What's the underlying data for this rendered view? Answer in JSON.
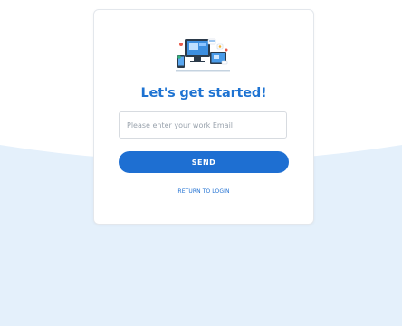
{
  "form": {
    "heading": "Let's get started!",
    "email_placeholder": "Please enter your work Email",
    "email_value": "",
    "send_label": "SEND",
    "return_label": "RETURN TO LOGIN"
  },
  "colors": {
    "accent": "#1e6fd2",
    "background_wave": "#e4f0fb",
    "card_background": "#ffffff"
  },
  "icons": {
    "illustration": "devices-illustration"
  }
}
